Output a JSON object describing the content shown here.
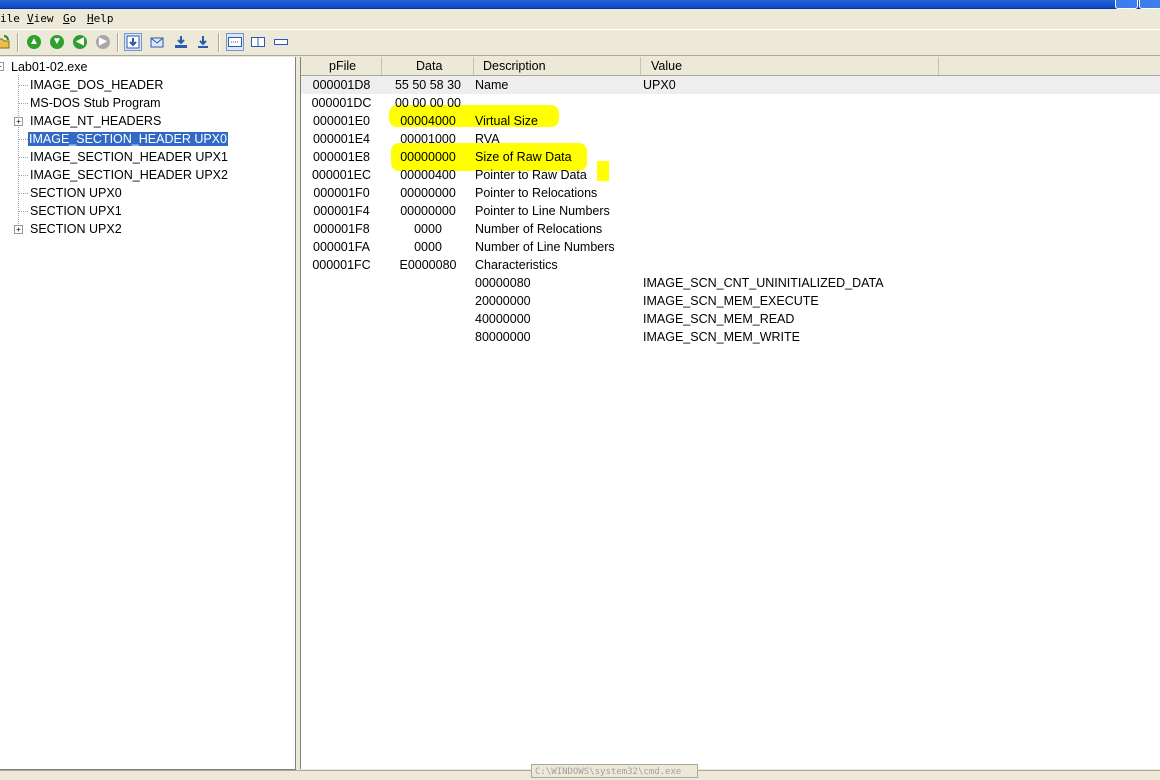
{
  "menu": {
    "file_ul": "",
    "file_rest": "ile",
    "view_ul": "V",
    "view_rest": "iew",
    "go_ul": "G",
    "go_rest": "o",
    "help_ul": "H",
    "help_rest": "elp"
  },
  "tree": {
    "root": "Lab01-02.exe",
    "items": [
      {
        "label": "IMAGE_DOS_HEADER"
      },
      {
        "label": "MS-DOS Stub Program"
      },
      {
        "label": "IMAGE_NT_HEADERS"
      },
      {
        "label": "IMAGE_SECTION_HEADER UPX0"
      },
      {
        "label": "IMAGE_SECTION_HEADER UPX1"
      },
      {
        "label": "IMAGE_SECTION_HEADER UPX2"
      },
      {
        "label": "SECTION UPX0"
      },
      {
        "label": "SECTION UPX1"
      },
      {
        "label": "SECTION UPX2"
      }
    ]
  },
  "table": {
    "columns": [
      "pFile",
      "Data",
      "Description",
      "Value"
    ],
    "rows": [
      {
        "pfile": "000001D8",
        "data": "55  50  58  30",
        "desc": "Name",
        "value": "UPX0"
      },
      {
        "pfile": "000001DC",
        "data": "00  00  00  00",
        "desc": "",
        "value": ""
      },
      {
        "pfile": "000001E0",
        "data": "00004000",
        "desc": "Virtual Size",
        "value": ""
      },
      {
        "pfile": "000001E4",
        "data": "00001000",
        "desc": "RVA",
        "value": ""
      },
      {
        "pfile": "000001E8",
        "data": "00000000",
        "desc": "Size of Raw Data",
        "value": ""
      },
      {
        "pfile": "000001EC",
        "data": "00000400",
        "desc": "Pointer to Raw Data",
        "value": ""
      },
      {
        "pfile": "000001F0",
        "data": "00000000",
        "desc": "Pointer to Relocations",
        "value": ""
      },
      {
        "pfile": "000001F4",
        "data": "00000000",
        "desc": "Pointer to Line Numbers",
        "value": ""
      },
      {
        "pfile": "000001F8",
        "data": "0000",
        "desc": "Number of Relocations",
        "value": ""
      },
      {
        "pfile": "000001FA",
        "data": "0000",
        "desc": "Number of Line Numbers",
        "value": ""
      },
      {
        "pfile": "000001FC",
        "data": "E0000080",
        "desc": "Characteristics",
        "value": ""
      },
      {
        "pfile": "",
        "data": "",
        "desc": "00000080",
        "value": "IMAGE_SCN_CNT_UNINITIALIZED_DATA"
      },
      {
        "pfile": "",
        "data": "",
        "desc": "20000000",
        "value": "IMAGE_SCN_MEM_EXECUTE"
      },
      {
        "pfile": "",
        "data": "",
        "desc": "40000000",
        "value": "IMAGE_SCN_MEM_READ"
      },
      {
        "pfile": "",
        "data": "",
        "desc": "80000000",
        "value": "IMAGE_SCN_MEM_WRITE"
      }
    ]
  },
  "status": {
    "taskbar_hint": "C:\\WINDOWS\\system32\\cmd.exe"
  },
  "colors": {
    "selection": "#316ac5",
    "highlight": "#ffff00",
    "window_bg": "#ece9d8"
  }
}
